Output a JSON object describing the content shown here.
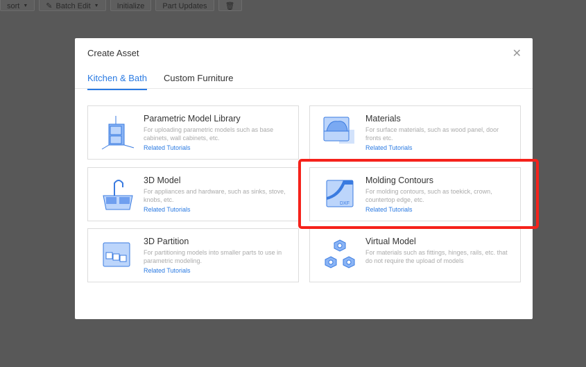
{
  "toolbar": {
    "sort": "sort",
    "batch_edit": "Batch Edit",
    "initialize": "Initialize",
    "part_updates": "Part Updates"
  },
  "modal": {
    "title": "Create Asset",
    "tabs": [
      {
        "label": "Kitchen & Bath"
      },
      {
        "label": "Custom Furniture"
      }
    ],
    "cards": [
      {
        "title": "Parametric Model Library",
        "desc": "For uploading parametric models such as base cabinets, wall cabinets, etc.",
        "link": "Related Tutorials"
      },
      {
        "title": "Materials",
        "desc": "For surface materials, such as wood panel, door fronts etc.",
        "link": "Related Tutorials"
      },
      {
        "title": "3D Model",
        "desc": "For appliances and hardware, such as sinks, stove, knobs, etc.",
        "link": "Related Tutorials"
      },
      {
        "title": "Molding Contours",
        "desc": "For molding contours, such as toekick, crown, countertop edge, etc.",
        "link": "Related Tutorials",
        "icon_text": "DXF"
      },
      {
        "title": "3D Partition",
        "desc": "For partitioning models into smaller parts to use in parametric modeling.",
        "link": "Related Tutorials"
      },
      {
        "title": "Virtual Model",
        "desc": "For materials such as fittings, hinges, rails, etc. that do not require the upload of models"
      }
    ]
  },
  "colors": {
    "accent": "#2a7ae2",
    "highlight": "#f5221b"
  }
}
